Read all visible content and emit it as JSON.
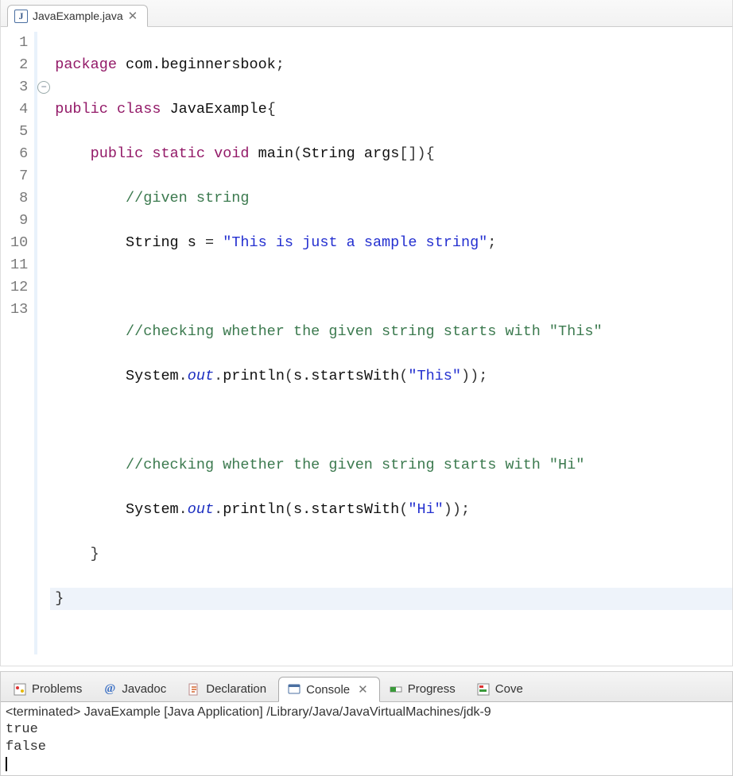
{
  "editor": {
    "tab_filename": "JavaExample.java",
    "line_numbers": [
      "1",
      "2",
      "3",
      "4",
      "5",
      "6",
      "7",
      "8",
      "9",
      "10",
      "11",
      "12",
      "13"
    ],
    "code": {
      "l1_package": "package",
      "l1_pkgname": "com.beginnersbook",
      "l2_public": "public",
      "l2_class": "class",
      "l2_name": "JavaExample",
      "l3_public": "public",
      "l3_static": "static",
      "l3_void": "void",
      "l3_main": "main",
      "l3_String": "String",
      "l3_args": "args",
      "l4_comment": "//given string",
      "l5_Type": "String",
      "l5_var": "s",
      "l5_eq": "=",
      "l5_str": "\"This is just a sample string\"",
      "l7_comment": "//checking whether the given string starts with \"This\"",
      "l8_System": "System",
      "l8_out": "out",
      "l8_println": "println",
      "l8_call": "s.startsWith",
      "l8_arg": "\"This\"",
      "l10_comment": "//checking whether the given string starts with \"Hi\"",
      "l11_System": "System",
      "l11_out": "out",
      "l11_println": "println",
      "l11_call": "s.startsWith",
      "l11_arg": "\"Hi\""
    }
  },
  "bottom": {
    "tabs": {
      "problems": "Problems",
      "javadoc": "Javadoc",
      "declaration": "Declaration",
      "console": "Console",
      "progress": "Progress",
      "coverage": "Cove"
    },
    "console": {
      "status": "<terminated> JavaExample [Java Application] /Library/Java/JavaVirtualMachines/jdk-9",
      "lines": [
        "true",
        "false"
      ]
    }
  }
}
